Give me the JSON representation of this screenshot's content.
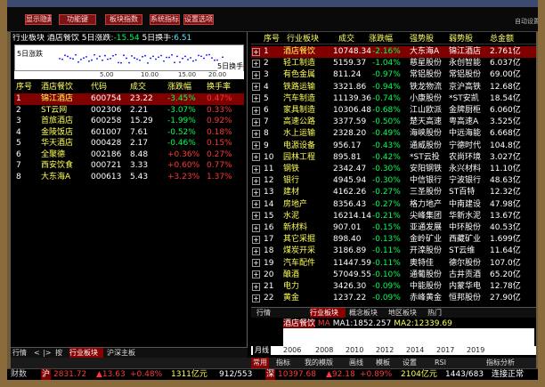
{
  "toolbar": {
    "buttons": [
      "显示隐藏",
      "功能键",
      "板块指数",
      "系统指标",
      "设置选项"
    ],
    "right_label": "自动设置"
  },
  "info": {
    "name": "行业板块",
    "sub": "酒店餐饮",
    "period": "5日涨跌",
    "change": "-15.54",
    "turnover_label": "5日换手",
    "turnover": "6.51"
  },
  "mini_chart": {
    "label": "5日涨跌",
    "axis_ticks": [
      "5.00",
      "10.00",
      "15.00",
      "20.00"
    ],
    "right_label": "5日换手",
    "dot_color": "#0000ff"
  },
  "left_table": {
    "headers": [
      "序号",
      "酒店餐饮",
      "代码",
      "成交",
      "涨跌幅",
      "换手率"
    ],
    "rows": [
      {
        "no": "1",
        "name": "锦江酒店",
        "code": "600754",
        "price": "23.22",
        "chg": "-3.45%",
        "turn": "0.47%",
        "dir": "grn",
        "selected": true
      },
      {
        "no": "2",
        "name": "ST云网",
        "code": "002306",
        "price": "2.21",
        "chg": "-3.07%",
        "turn": "0.33%",
        "dir": "grn",
        "selected": false
      },
      {
        "no": "3",
        "name": "首旅酒店",
        "code": "600258",
        "price": "15.29",
        "chg": "-1.99%",
        "turn": "0.92%",
        "dir": "grn",
        "selected": false
      },
      {
        "no": "4",
        "name": "金陵饭店",
        "code": "601007",
        "price": "7.61",
        "chg": "-0.52%",
        "turn": "0.18%",
        "dir": "grn",
        "selected": false
      },
      {
        "no": "5",
        "name": "华天酒店",
        "code": "000428",
        "price": "2.17",
        "chg": "-0.46%",
        "turn": "0.15%",
        "dir": "grn",
        "selected": false
      },
      {
        "no": "6",
        "name": "全聚德",
        "code": "002186",
        "price": "8.48",
        "chg": "+0.36%",
        "turn": "0.27%",
        "dir": "red",
        "selected": false
      },
      {
        "no": "7",
        "name": "西安饮食",
        "code": "000721",
        "price": "3.33",
        "chg": "+0.60%",
        "turn": "0.77%",
        "dir": "red",
        "selected": false
      },
      {
        "no": "8",
        "name": "大东海A",
        "code": "000613",
        "price": "5.43",
        "chg": "+3.23%",
        "turn": "1.37%",
        "dir": "red",
        "selected": false
      }
    ]
  },
  "left_tabs": [
    "行情",
    "<",
    "|>",
    "按",
    "行业板块",
    "沪深主板"
  ],
  "right_table": {
    "headers": [
      "序号",
      "行业板块",
      "成交",
      "涨跌幅",
      "强势股",
      "弱势股",
      "总金额"
    ],
    "rows": [
      {
        "no": "1",
        "name": "酒店餐饮",
        "price": "10748.34",
        "chg": "-2.16%",
        "strong": "大东海A",
        "weak": "锦江酒店",
        "amt": "2.761亿",
        "selected": true
      },
      {
        "no": "2",
        "name": "轻工制造",
        "price": "5159.37",
        "chg": "-1.04%",
        "strong": "慈星股份",
        "weak": "永创智能",
        "amt": "6.037亿"
      },
      {
        "no": "3",
        "name": "有色金属",
        "price": "811.24",
        "chg": "-0.97%",
        "strong": "常铝股份",
        "weak": "常铝股份",
        "amt": "69.00亿"
      },
      {
        "no": "4",
        "name": "铁路运输",
        "price": "3321.86",
        "chg": "-0.94%",
        "strong": "铁龙物流",
        "weak": "京沪高铁",
        "amt": "12.68亿"
      },
      {
        "no": "5",
        "name": "汽车制造",
        "price": "11139.36",
        "chg": "-0.74%",
        "strong": "小康股份",
        "weak": "*ST安凯",
        "amt": "18.54亿"
      },
      {
        "no": "6",
        "name": "家具制造",
        "price": "10306.48",
        "chg": "-0.68%",
        "strong": "江山欧派",
        "weak": "金牌厨柜",
        "amt": "6.060亿"
      },
      {
        "no": "7",
        "name": "高速公路",
        "price": "3377.59",
        "chg": "-0.50%",
        "strong": "楚天高速",
        "weak": "粤高速A",
        "amt": "3.525亿"
      },
      {
        "no": "8",
        "name": "水上运输",
        "price": "2328.20",
        "chg": "-0.49%",
        "strong": "海峡股份",
        "weak": "中远海能",
        "amt": "6.668亿"
      },
      {
        "no": "9",
        "name": "电源设备",
        "price": "956.17",
        "chg": "-0.43%",
        "strong": "通威股份",
        "weak": "宁德时代",
        "amt": "104.8亿"
      },
      {
        "no": "10",
        "name": "园林工程",
        "price": "895.81",
        "chg": "-0.42%",
        "strong": "*ST云投",
        "weak": "农尚环境",
        "amt": "3.027亿"
      },
      {
        "no": "11",
        "name": "钢铁",
        "price": "2342.47",
        "chg": "-0.30%",
        "strong": "安阳钢铁",
        "weak": "永兴材料",
        "amt": "11.10亿"
      },
      {
        "no": "12",
        "name": "银行",
        "price": "4945.94",
        "chg": "-0.30%",
        "strong": "中信银行",
        "weak": "宁波银行",
        "amt": "48.63亿"
      },
      {
        "no": "13",
        "name": "建材",
        "price": "4162.26",
        "chg": "-0.27%",
        "strong": "三圣股份",
        "weak": "ST百特",
        "amt": "12.32亿"
      },
      {
        "no": "14",
        "name": "房地产",
        "price": "8356.43",
        "chg": "-0.27%",
        "strong": "格力地产",
        "weak": "中南建设",
        "amt": "47.98亿"
      },
      {
        "no": "15",
        "name": "水泥",
        "price": "16214.14",
        "chg": "-0.21%",
        "strong": "尖峰集团",
        "weak": "华新水泥",
        "amt": "13.67亿"
      },
      {
        "no": "16",
        "name": "新材料",
        "price": "907.01",
        "chg": "-0.15%",
        "strong": "亚通发展",
        "weak": "中环股份",
        "amt": "40.53亿"
      },
      {
        "no": "17",
        "name": "其它采掘",
        "price": "898.40",
        "chg": "-0.13%",
        "strong": "金岭矿业",
        "weak": "西藏矿业",
        "amt": "1.699亿"
      },
      {
        "no": "18",
        "name": "煤炭开采",
        "price": "3186.89",
        "chg": "-0.11%",
        "strong": "开滦股份",
        "weak": "ST云维",
        "amt": "11.64亿"
      },
      {
        "no": "19",
        "name": "汽车配件",
        "price": "11447.59",
        "chg": "-0.11%",
        "strong": "奥特佳",
        "weak": "德尔股份",
        "amt": "107.0亿"
      },
      {
        "no": "20",
        "name": "酿酒",
        "price": "57049.55",
        "chg": "-0.10%",
        "strong": "通葡股份",
        "weak": "古井贡酒",
        "amt": "65.20亿"
      },
      {
        "no": "21",
        "name": "电力",
        "price": "3426.30",
        "chg": "-0.09%",
        "strong": "中能股份",
        "weak": "内蒙华电",
        "amt": "12.78亿"
      },
      {
        "no": "22",
        "name": "黄金",
        "price": "1237.22",
        "chg": "-0.09%",
        "strong": "赤峰黄金",
        "weak": "恒邦股份",
        "amt": "27.90亿"
      }
    ]
  },
  "right_tabs": [
    "行情",
    "行业板块",
    "概念板块",
    "地区板块",
    "热门"
  ],
  "mini_panel": {
    "title": "酒店餐饮",
    "ma_label": "MA",
    "ma1": "MA1:1852.257",
    "ma2": "MA2:12339.69",
    "period": "月线",
    "years": [
      "2006",
      "2008",
      "2010",
      "2012",
      "2014",
      "2017",
      "2019"
    ]
  },
  "nav": [
    "常用",
    "指标",
    "我的模版",
    "画线",
    "模板",
    "设置",
    "RSI",
    "指标分析"
  ],
  "status": {
    "label": "财数",
    "sh_label": "沪",
    "sh_index": "2831.72",
    "sh_change": "▲13.63",
    "sh_pct": "+0.48%",
    "sh_amt": "1311亿元",
    "sh_count": "912/553",
    "sz_label": "深",
    "sz_index": "10397.68",
    "sz_change": "▲92.18",
    "sz_pct": "+0.89%",
    "sz_amt": "2104亿元",
    "sz_count": "1443/683",
    "connect": "连接正常"
  }
}
